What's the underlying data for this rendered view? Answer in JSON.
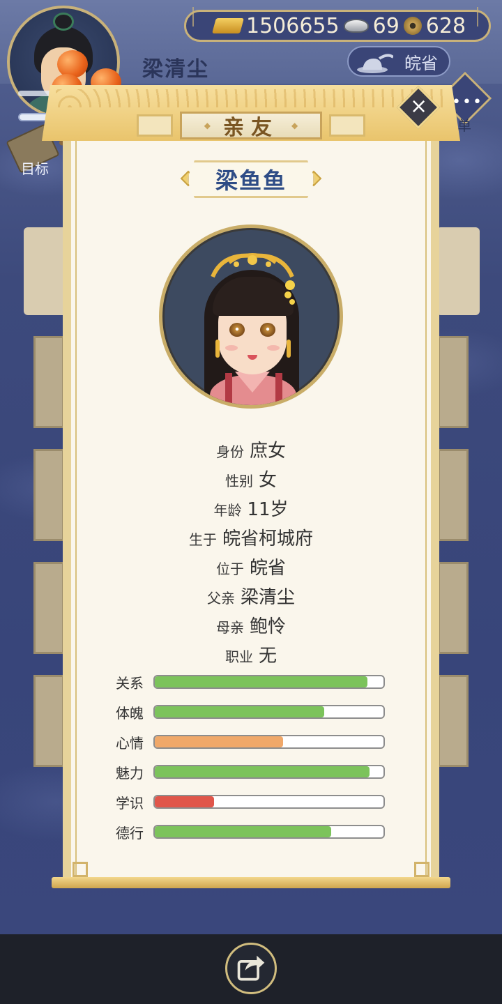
{
  "player": {
    "name": "梁清尘",
    "region": "皖省"
  },
  "currency": {
    "gold": "1506655",
    "silver": "69",
    "coin": "628"
  },
  "nav": {
    "menu_label": "菜单",
    "target_label": "目标"
  },
  "dialog": {
    "title": "亲友",
    "character_name": "梁鱼鱼",
    "info": [
      {
        "label": "身份",
        "value": "庶女"
      },
      {
        "label": "性别",
        "value": "女"
      },
      {
        "label": "年龄",
        "value": "11岁"
      },
      {
        "label": "生于",
        "value": "皖省柯城府"
      },
      {
        "label": "位于",
        "value": "皖省"
      },
      {
        "label": "父亲",
        "value": "梁清尘"
      },
      {
        "label": "母亲",
        "value": "鲍怜"
      },
      {
        "label": "职业",
        "value": "无"
      }
    ],
    "stats": [
      {
        "label": "关系",
        "level": 0.93,
        "color": "#7cc35b"
      },
      {
        "label": "体魄",
        "level": 0.74,
        "color": "#7cc35b"
      },
      {
        "label": "心情",
        "level": 0.56,
        "color": "#f0a869"
      },
      {
        "label": "魅力",
        "level": 0.94,
        "color": "#7cc35b"
      },
      {
        "label": "学识",
        "level": 0.26,
        "color": "#e0564a"
      },
      {
        "label": "德行",
        "level": 0.77,
        "color": "#7cc35b"
      }
    ]
  },
  "icons": {
    "close": "close-icon",
    "share": "share-icon"
  }
}
